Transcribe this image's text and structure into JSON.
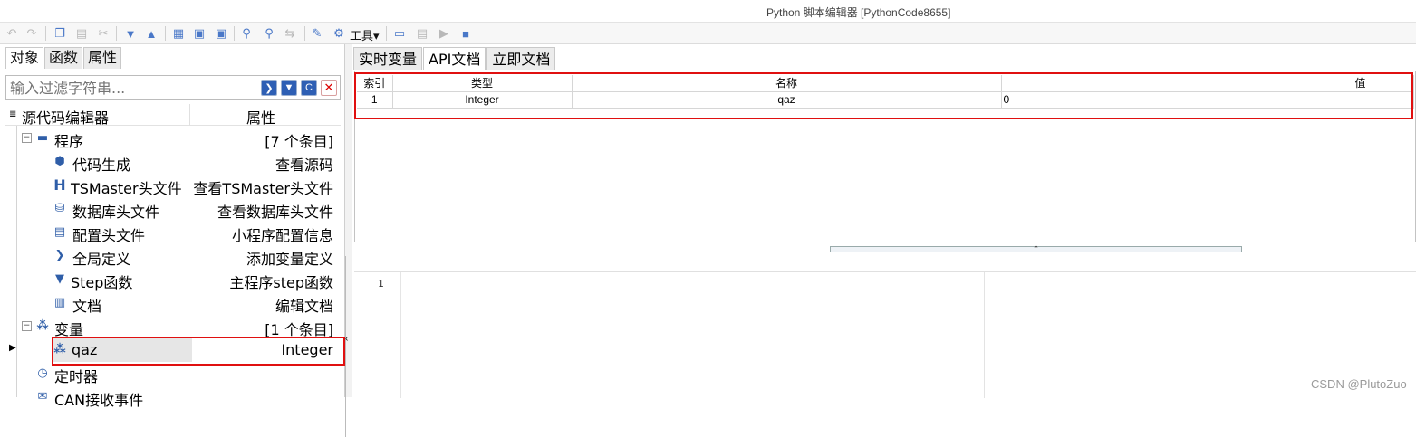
{
  "window": {
    "title": "Python 脚本编辑器 [PythonCode8655]"
  },
  "toolbar": {
    "tools_label": "工具",
    "tools_arrow": "▾"
  },
  "left_tabs": [
    "对象",
    "函数",
    "属性"
  ],
  "filter": {
    "placeholder": "输入过滤字符串..."
  },
  "tree_header": {
    "col1": "源代码编辑器",
    "col2": "属性"
  },
  "tree": {
    "program": {
      "label": "程序",
      "value": "[7 个条目]"
    },
    "program_items": [
      {
        "name": "代码生成",
        "value": "查看源码",
        "icon": "c-gear-icon"
      },
      {
        "name": "TSMaster头文件",
        "value": "查看TSMaster头文件",
        "icon": "h-letter-icon"
      },
      {
        "name": "数据库头文件",
        "value": "查看数据库头文件",
        "icon": "database-icon"
      },
      {
        "name": "配置头文件",
        "value": "小程序配置信息",
        "icon": "config-file-icon"
      },
      {
        "name": "全局定义",
        "value": "添加变量定义",
        "icon": "terminal-icon"
      },
      {
        "name": "Step函数",
        "value": "主程序step函数",
        "icon": "triangle-down-icon"
      },
      {
        "name": "文档",
        "value": "编辑文档",
        "icon": "book-icon"
      }
    ],
    "variables": {
      "label": "变量",
      "value": "[1 个条目]"
    },
    "variable_items": [
      {
        "name": "qaz",
        "value": "Integer"
      }
    ],
    "timer": {
      "label": "定时器"
    },
    "can_event": {
      "label": "CAN接收事件"
    }
  },
  "right_tabs": [
    "实时变量",
    "API文档",
    "立即文档"
  ],
  "grid": {
    "headers": [
      "索引",
      "类型",
      "名称",
      "值"
    ],
    "rows": [
      {
        "index": "1",
        "type": "Integer",
        "name": "qaz",
        "value": "0"
      }
    ]
  },
  "editor": {
    "line_numbers": [
      "1"
    ]
  },
  "watermark": "CSDN @PlutoZuo"
}
